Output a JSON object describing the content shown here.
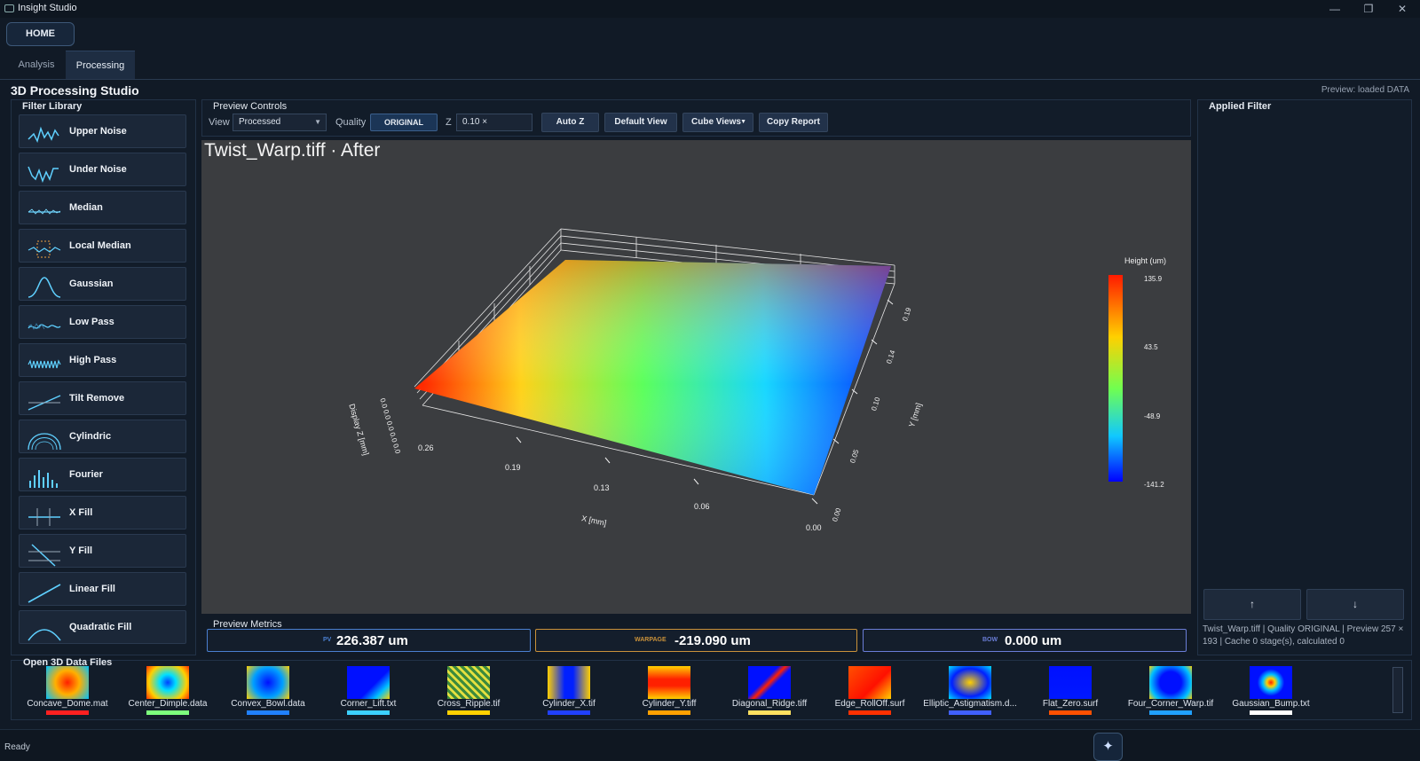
{
  "app": {
    "title": "Insight Studio",
    "win_min": "—",
    "win_restore": "❐",
    "win_close": "✕"
  },
  "home_label": "HOME",
  "tabs": [
    "Analysis",
    "Processing"
  ],
  "studio_title": "3D Processing Studio",
  "preview_status": "Preview: loaded DATA",
  "filter_library": {
    "label": "Filter Library",
    "items": [
      {
        "label": "Upper Noise",
        "icon": "upper-noise-icon"
      },
      {
        "label": "Under Noise",
        "icon": "under-noise-icon"
      },
      {
        "label": "Median",
        "icon": "median-icon"
      },
      {
        "label": "Local Median",
        "icon": "local-median-icon"
      },
      {
        "label": "Gaussian",
        "icon": "gaussian-icon"
      },
      {
        "label": "Low Pass",
        "icon": "low-pass-icon"
      },
      {
        "label": "High Pass",
        "icon": "high-pass-icon"
      },
      {
        "label": "Tilt Remove",
        "icon": "tilt-remove-icon"
      },
      {
        "label": "Cylindric",
        "icon": "cylindric-icon"
      },
      {
        "label": "Fourier",
        "icon": "fourier-icon"
      },
      {
        "label": "X Fill",
        "icon": "x-fill-icon"
      },
      {
        "label": "Y Fill",
        "icon": "y-fill-icon"
      },
      {
        "label": "Linear Fill",
        "icon": "linear-fill-icon"
      },
      {
        "label": "Quadratic Fill",
        "icon": "quadratic-fill-icon"
      }
    ]
  },
  "preview_controls": {
    "label": "Preview Controls",
    "view_label": "View",
    "view_value": "Processed",
    "quality_label": "Quality",
    "quality_value": "ORIGINAL",
    "z_label": "Z",
    "z_value": "0.10 ×",
    "auto_z": "Auto Z",
    "default_view": "Default View",
    "cube_views": "Cube Views",
    "copy_report": "Copy Report"
  },
  "plot": {
    "title": "Twist_Warp.tiff · After",
    "z_axis_label": "Display Z [mm]",
    "z_ticks": "0.0 0.0 0.0 0.0 0.0",
    "x_axis_label": "X [mm]",
    "x_ticks": [
      "0.26",
      "0.19",
      "0.13",
      "0.06",
      "0.00"
    ],
    "y_axis_label": "Y [mm]",
    "y_ticks": [
      "0.00",
      "0.05",
      "0.10",
      "0.14",
      "0.19"
    ],
    "colorbar_title": "Height (um)",
    "colorbar_ticks": [
      "135.9",
      "43.5",
      "-48.9",
      "-141.2"
    ]
  },
  "metrics": {
    "label": "Preview Metrics",
    "pv_label": "PV",
    "pv_value": "226.387 um",
    "warpage_label": "WARPAGE",
    "warpage_value": "-219.090 um",
    "bow_label": "BOW",
    "bow_value": "0.000 um",
    "colors": {
      "pv": "#4a7fd0",
      "warpage": "#c9913a",
      "bow": "#6a7dd6"
    }
  },
  "applied_filter": {
    "label": "Applied Filter",
    "up": "↑",
    "down": "↓",
    "info": "Twist_Warp.tiff | Quality ORIGINAL | Preview 257 × 193 | Cache 0 stage(s), calculated 0"
  },
  "open_files": {
    "label": "Open 3D Data Files",
    "items": [
      "Concave_Dome.mat",
      "Center_Dimple.data",
      "Convex_Bowl.data",
      "Corner_Lift.txt",
      "Cross_Ripple.tif",
      "Cylinder_X.tif",
      "Cylinder_Y.tiff",
      "Diagonal_Ridge.tiff",
      "Edge_RollOff.surf",
      "Elliptic_Astigmatism.d...",
      "Flat_Zero.surf",
      "Four_Corner_Warp.tif",
      "Gaussian_Bump.txt"
    ]
  },
  "status": "Ready",
  "assist_icon": "✦"
}
